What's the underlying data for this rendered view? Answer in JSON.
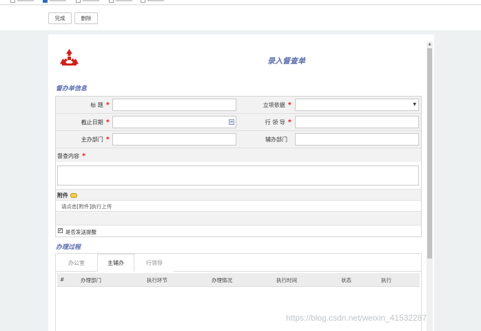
{
  "toolbar": {
    "done_label": "完成",
    "delete_label": "删除"
  },
  "form": {
    "title": "录入督查单",
    "section_info": "督办单信息",
    "fields": {
      "title_label": "标  题",
      "basis_label": "立项依据",
      "deadline_label": "截止日期",
      "leader_label": "行 领 导",
      "main_dept_label": "主办部门",
      "assist_dept_label": "辅办部门",
      "content_label": "督查内容",
      "attachment_label": "附件",
      "attachment_hint": "请点击[附件]执行上传",
      "send_reminder_label": "是否发送提醒"
    },
    "required_mark": "*"
  },
  "process": {
    "section_title": "办理过程",
    "tabs": [
      {
        "label": "办公室"
      },
      {
        "label": "主辅办"
      },
      {
        "label": "行领导"
      }
    ],
    "columns": [
      "#",
      "办理部门",
      "执行环节",
      "办理情况",
      "执行时间",
      "状态",
      "执行"
    ]
  },
  "watermark": "https://blog.csdn.net/weixin_41532287",
  "colors": {
    "accent": "#5a6fb0",
    "required": "#e02020",
    "logo": "#d0201b"
  },
  "icons": {
    "calendar": "calendar-icon",
    "dropdown": "chevron-down-icon",
    "attachment": "folder-icon",
    "logo": "bank-logo"
  }
}
